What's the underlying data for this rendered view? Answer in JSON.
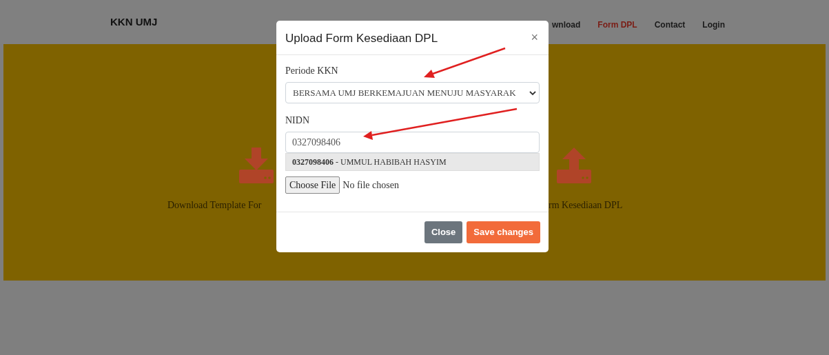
{
  "navbar": {
    "brand": "KKN UMJ",
    "links": [
      {
        "label": "wnload",
        "selected": false
      },
      {
        "label": "Form DPL",
        "selected": true
      },
      {
        "label": "Contact",
        "selected": false
      },
      {
        "label": "Login",
        "selected": false
      }
    ]
  },
  "hero": {
    "cards": [
      {
        "kind": "download",
        "label": "Download Template For"
      },
      {
        "kind": "upload",
        "label": "rm Kesediaan DPL"
      }
    ]
  },
  "modal": {
    "title": "Upload Form Kesediaan DPL",
    "close_symbol": "×",
    "fields": [
      {
        "kind": "select",
        "label": "Periode KKN",
        "value": "BERSAMA UMJ BERKEMAJUAN MENUJU MASYARAK"
      },
      {
        "kind": "text",
        "label": "NIDN",
        "value": "0327098406",
        "suggestions": [
          {
            "text": "**0327098406** - UMMUL HABIBAH HASYIM",
            "selected": true
          }
        ]
      },
      {
        "kind": "file",
        "button": "Choose File",
        "status": "No file chosen"
      }
    ],
    "buttons": [
      {
        "label": "Close",
        "kind": "secondary"
      },
      {
        "label": "Save changes",
        "kind": "primary"
      }
    ]
  }
}
